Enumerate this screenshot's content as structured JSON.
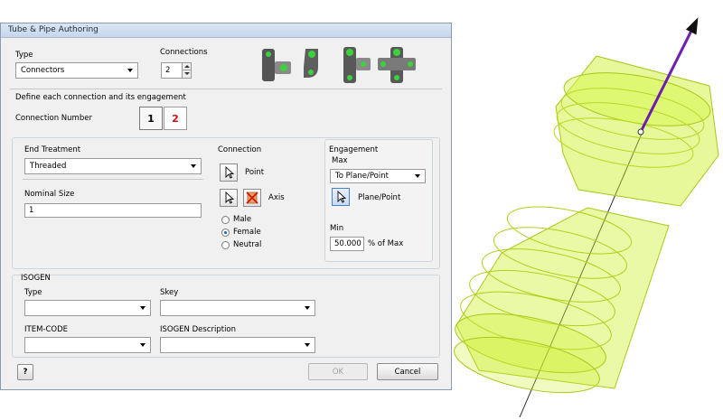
{
  "window": {
    "title": "Tube & Pipe Authoring"
  },
  "type": {
    "label": "Type",
    "value": "Connectors"
  },
  "connections": {
    "label": "Connections",
    "value": "2"
  },
  "fittings_icons": [
    "tee-fitting-icon",
    "elbow-fitting-icon",
    "cross-fitting-icon",
    "four-way-fitting-icon"
  ],
  "define_heading": "Define each connection and its engagement",
  "connection_number": {
    "label": "Connection Number",
    "buttons": [
      "1",
      "2"
    ]
  },
  "end_treatment": {
    "label": "End Treatment",
    "value": "Threaded"
  },
  "nominal_size": {
    "label": "Nominal Size",
    "value": "1"
  },
  "connection_group": {
    "label": "Connection",
    "point_label": "Point",
    "axis_label": "Axis",
    "radios": [
      {
        "label": "Male",
        "checked": false
      },
      {
        "label": "Female",
        "checked": true
      },
      {
        "label": "Neutral",
        "checked": false
      }
    ]
  },
  "engagement": {
    "label": "Engagement",
    "max_label": "Max",
    "max_value": "To Plane/Point",
    "plane_point_label": "Plane/Point",
    "min_label": "Min",
    "min_value": "50.000",
    "min_unit": "% of Max"
  },
  "isogen": {
    "label": "ISOGEN",
    "type_label": "Type",
    "type_value": "",
    "skey_label": "Skey",
    "skey_value": "",
    "item_code_label": "ITEM-CODE",
    "item_code_value": "",
    "description_label": "ISOGEN Description",
    "description_value": ""
  },
  "buttons": {
    "help": "?",
    "ok": "OK",
    "cancel": "Cancel"
  },
  "colors": {
    "accent_red": "#d01010",
    "model_green": "#c8f020",
    "axis_purple": "#6a1fb0"
  }
}
